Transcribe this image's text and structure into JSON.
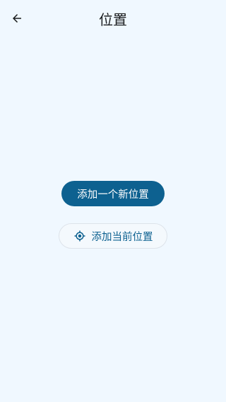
{
  "header": {
    "back_icon": "arrow-back-icon",
    "title": "位置"
  },
  "actions": {
    "add_new_location_label": "添加一个新位置",
    "add_current_location_label": "添加当前位置",
    "add_current_location_icon": "my-location-icon"
  },
  "colors": {
    "background": "#f0f8ff",
    "primary": "#0d6190",
    "on_primary": "#ffffff",
    "outline": "#dde3ea",
    "title_text": "#1a1c1e"
  }
}
